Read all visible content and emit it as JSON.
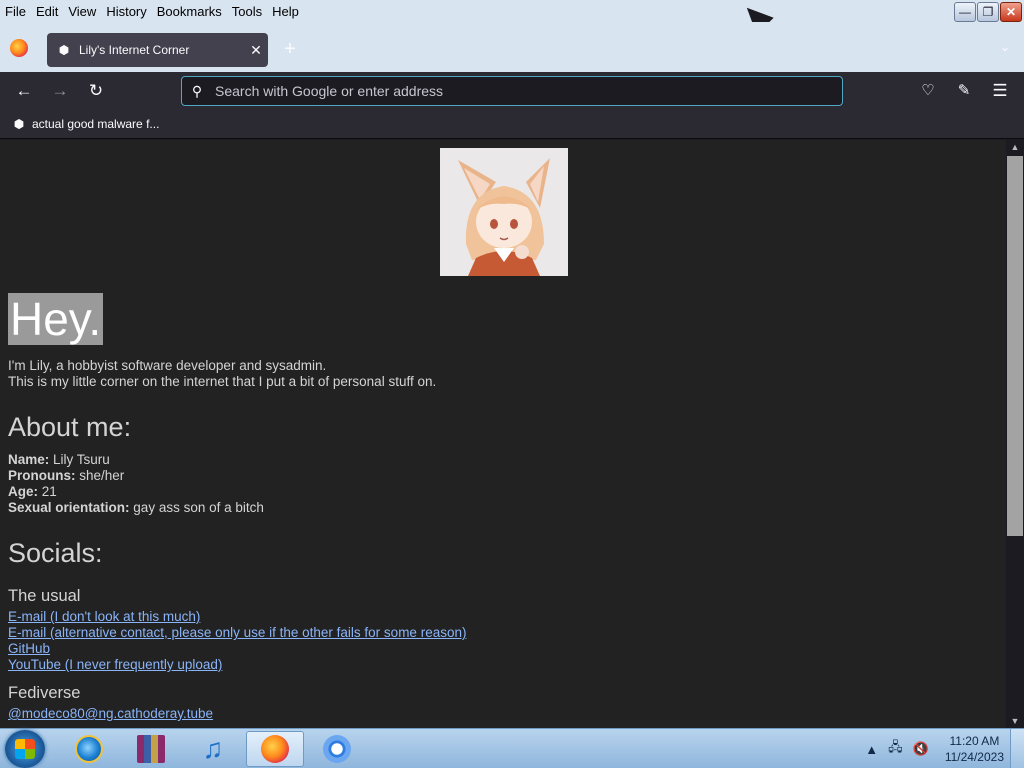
{
  "menubar": {
    "items": [
      "File",
      "Edit",
      "View",
      "History",
      "Bookmarks",
      "Tools",
      "Help"
    ]
  },
  "window_controls": {
    "minimize": "—",
    "restore": "❐",
    "close": "✕"
  },
  "tabs": [
    {
      "title": "Lily's Internet Corner",
      "close": "✕"
    }
  ],
  "new_tab_symbol": "+",
  "navbar": {
    "back": "←",
    "forward": "→",
    "reload": "↻",
    "search_placeholder": "Search with Google or enter address"
  },
  "bookmarks": [
    {
      "label": "actual good malware f..."
    }
  ],
  "page": {
    "greeting": "Hey.",
    "intro_line1": "I'm Lily, a hobbyist software developer and sysadmin.",
    "intro_line2": "This is my little corner on the internet that I put a bit of personal stuff on.",
    "about_heading": "About me:",
    "about": [
      {
        "label": "Name:",
        "value": "Lily Tsuru"
      },
      {
        "label": "Pronouns:",
        "value": "she/her"
      },
      {
        "label": "Age:",
        "value": "21"
      },
      {
        "label": "Sexual orientation:",
        "value": "gay ass son of a bitch"
      }
    ],
    "socials_heading": "Socials:",
    "usual_heading": "The usual",
    "usual_links": [
      "E-mail (I don't look at this much)",
      "E-mail (alternative contact, please only use if the other fails for some reason)",
      "GitHub",
      "YouTube (I never frequently upload)"
    ],
    "fediverse_heading": "Fediverse",
    "fediverse_links": [
      "@modeco80@ng.cathoderay.tube"
    ]
  },
  "taskbar": {
    "apps": [
      "Internet Explorer",
      "WinRAR",
      "iTunes",
      "Firefox",
      "Chromium"
    ],
    "active_app": "Firefox",
    "clock_time": "11:20 AM",
    "clock_date": "11/24/2023"
  },
  "colors": {
    "link": "#8ab4f8",
    "page_bg": "#222222",
    "toolbar_bg": "#2b2a33",
    "url_focus": "#4ea8c4"
  }
}
